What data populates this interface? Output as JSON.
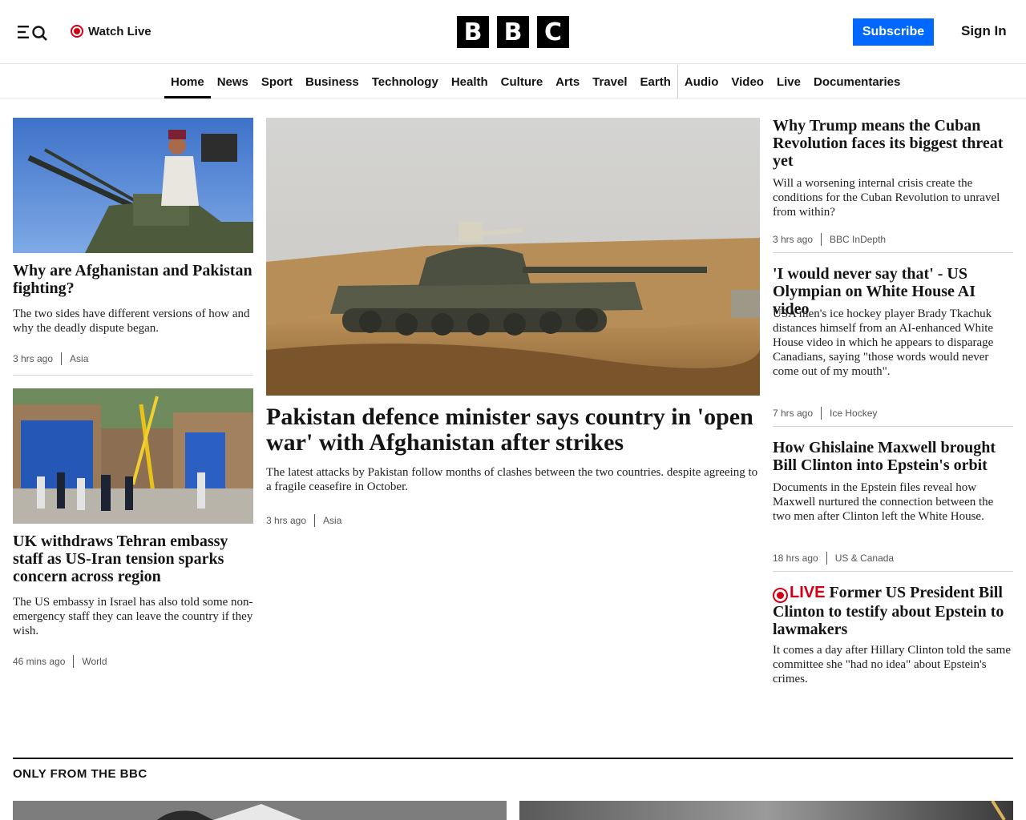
{
  "header": {
    "watch_live": "Watch Live",
    "logo": [
      "B",
      "B",
      "C"
    ],
    "subscribe": "Subscribe",
    "sign_in": "Sign In"
  },
  "nav": {
    "items": [
      "Home",
      "News",
      "Sport",
      "Business",
      "Technology",
      "Health",
      "Culture",
      "Arts",
      "Travel",
      "Earth",
      "Audio",
      "Video",
      "Live",
      "Documentaries"
    ],
    "active": "Home"
  },
  "left": {
    "story1": {
      "headline": "Why are Afghanistan and Pakistan fighting?",
      "summary": "The two sides have different versions of how and why the deadly dispute began.",
      "time": "3 hrs ago",
      "section": "Asia"
    },
    "story2": {
      "headline": "UK withdraws Tehran embassy staff as US-Iran tension sparks concern across region",
      "summary": "The US embassy in Israel has also told some non-emergency staff they can leave the country if they wish.",
      "time": "46 mins ago",
      "section": "World"
    }
  },
  "main": {
    "headline": "Pakistan defence minister says country in 'open war' with Afghanistan after strikes",
    "summary": "The latest attacks by Pakistan follow months of clashes between the two countries. despite agreeing to a fragile ceasefire in October.",
    "time": "3 hrs ago",
    "section": "Asia"
  },
  "right": {
    "story1": {
      "headline": "Why Trump means the Cuban Revolution faces its biggest threat yet",
      "summary": "Will a worsening internal crisis create the conditions for the Cuban Revolution to unravel from within?",
      "time": "3 hrs ago",
      "section": "BBC InDepth"
    },
    "story2": {
      "headline": "'I would never say that' - US Olympian on White House AI video",
      "summary": "USA men's ice hockey player Brady Tkachuk distances himself from an AI-enhanced White House video in which he appears to disparage Canadians, saying \"those words would never come out of my mouth\".",
      "time": "7 hrs ago",
      "section": "Ice Hockey"
    },
    "story3": {
      "headline": "How Ghislaine Maxwell brought Bill Clinton into Epstein's orbit",
      "summary": "Documents in the Epstein files reveal how Maxwell nurtured the connection between the two men after Clinton left the White House.",
      "time": "18 hrs ago",
      "section": "US & Canada"
    },
    "story4": {
      "live_label": "LIVE",
      "headline": "Former US President Bill Clinton to testify about Epstein to lawmakers",
      "summary": "It comes a day after Hillary Clinton told the same committee she \"had no idea\" about Epstein's crimes."
    }
  },
  "section": {
    "title": "ONLY FROM THE BBC"
  },
  "colors": {
    "brand_blue": "#0068ff",
    "live_red": "#d20014"
  },
  "icons": [
    "menu-icon",
    "search-icon",
    "live-dot-icon"
  ]
}
